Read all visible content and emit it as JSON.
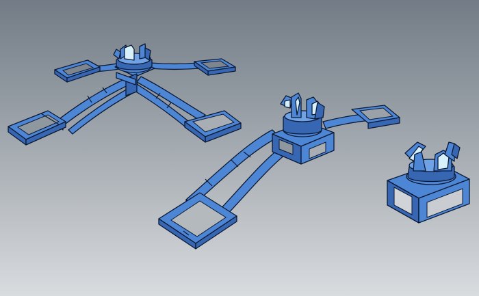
{
  "viewport": {
    "background_top": "#737c86",
    "background_bottom": "#d9dcdf"
  },
  "model": {
    "face_color": "#4d86d4",
    "face_shade_color": "#3767b3",
    "face_light_color": "#6fa3e6",
    "edge_color": "#0b1833",
    "highlight_color": "#d7f1fb",
    "parts": [
      {
        "name": "four-arm-spider-bracket"
      },
      {
        "name": "two-arm-bracket-with-clip"
      },
      {
        "name": "clip-base-block"
      }
    ]
  }
}
